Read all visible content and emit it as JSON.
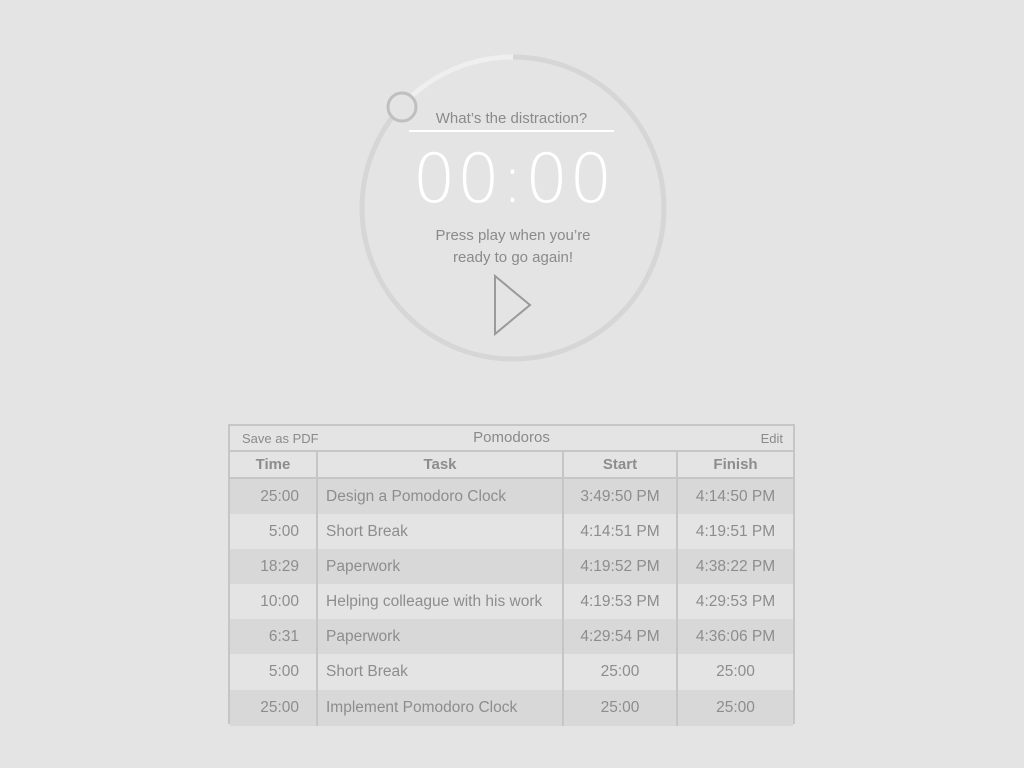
{
  "timer": {
    "distraction_placeholder": "What’s the distraction?",
    "time": "00:00",
    "message_line1": "Press play when you’re",
    "message_line2": "ready to go again!",
    "progress": 0.02,
    "play_icon": "play-icon",
    "colors": {
      "ring": "#d6d6d6",
      "ring_progress": "#f2f2f2",
      "clock_text": "#ffffff"
    }
  },
  "table": {
    "save_label": "Save as PDF",
    "title": "Pomodoros",
    "edit_label": "Edit",
    "columns": [
      "Time",
      "Task",
      "Start",
      "Finish"
    ],
    "rows": [
      {
        "time": "25:00",
        "task": "Design a Pomodoro Clock",
        "start": "3:49:50 PM",
        "finish": "4:14:50 PM"
      },
      {
        "time": "5:00",
        "task": "Short Break",
        "start": "4:14:51 PM",
        "finish": "4:19:51 PM"
      },
      {
        "time": "18:29",
        "task": "Paperwork",
        "start": "4:19:52 PM",
        "finish": "4:38:22 PM"
      },
      {
        "time": "10:00",
        "task": "Helping colleague with his work",
        "start": "4:19:53 PM",
        "finish": "4:29:53 PM"
      },
      {
        "time": "6:31",
        "task": "Paperwork",
        "start": "4:29:54 PM",
        "finish": "4:36:06 PM"
      },
      {
        "time": "5:00",
        "task": "Short Break",
        "start": "25:00",
        "finish": "25:00"
      },
      {
        "time": "25:00",
        "task": "Implement Pomodoro Clock",
        "start": "25:00",
        "finish": "25:00"
      }
    ]
  }
}
